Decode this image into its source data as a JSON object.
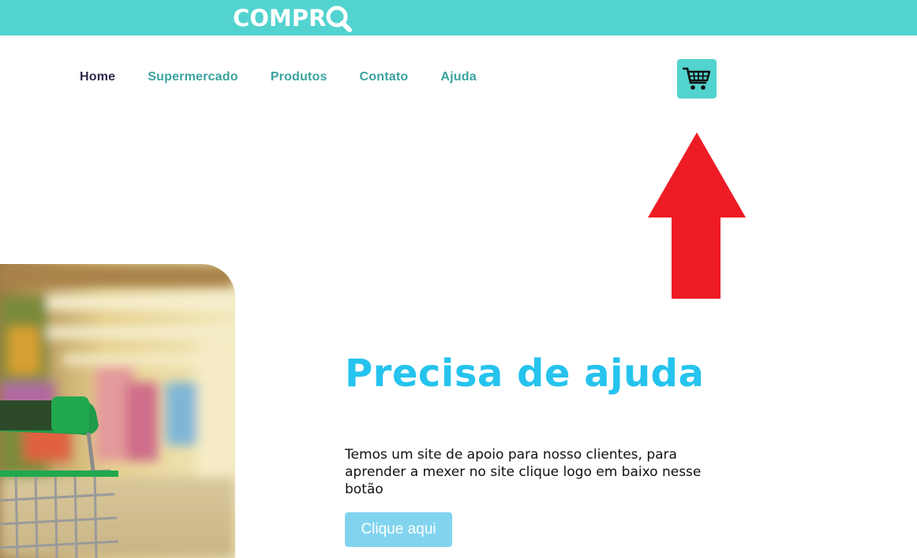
{
  "brand": {
    "logo_text": "COMPR",
    "logo_icon": "magnifier-icon",
    "colors": {
      "topbar": "#52d3cf",
      "nav_link": "#3aa3a0",
      "nav_active": "#2d2b4a",
      "title": "#25c3ee",
      "button": "#82d4ee",
      "arrow": "#ed1c24"
    }
  },
  "nav": {
    "items": [
      {
        "label": "Home",
        "active": true
      },
      {
        "label": "Supermercado",
        "active": false
      },
      {
        "label": "Produtos",
        "active": false
      },
      {
        "label": "Contato",
        "active": false
      },
      {
        "label": "Ajuda",
        "active": false
      }
    ],
    "cart_icon": "shopping-cart-icon"
  },
  "annotation": {
    "icon": "red-up-arrow"
  },
  "hero": {
    "image": "supermarket-cart-photo"
  },
  "help": {
    "title": "Precisa de ajuda",
    "text": "Temos um site de apoio para nosso clientes, para aprender a mexer no site clique logo em baixo nesse botão",
    "button_label": "Clique aqui"
  }
}
